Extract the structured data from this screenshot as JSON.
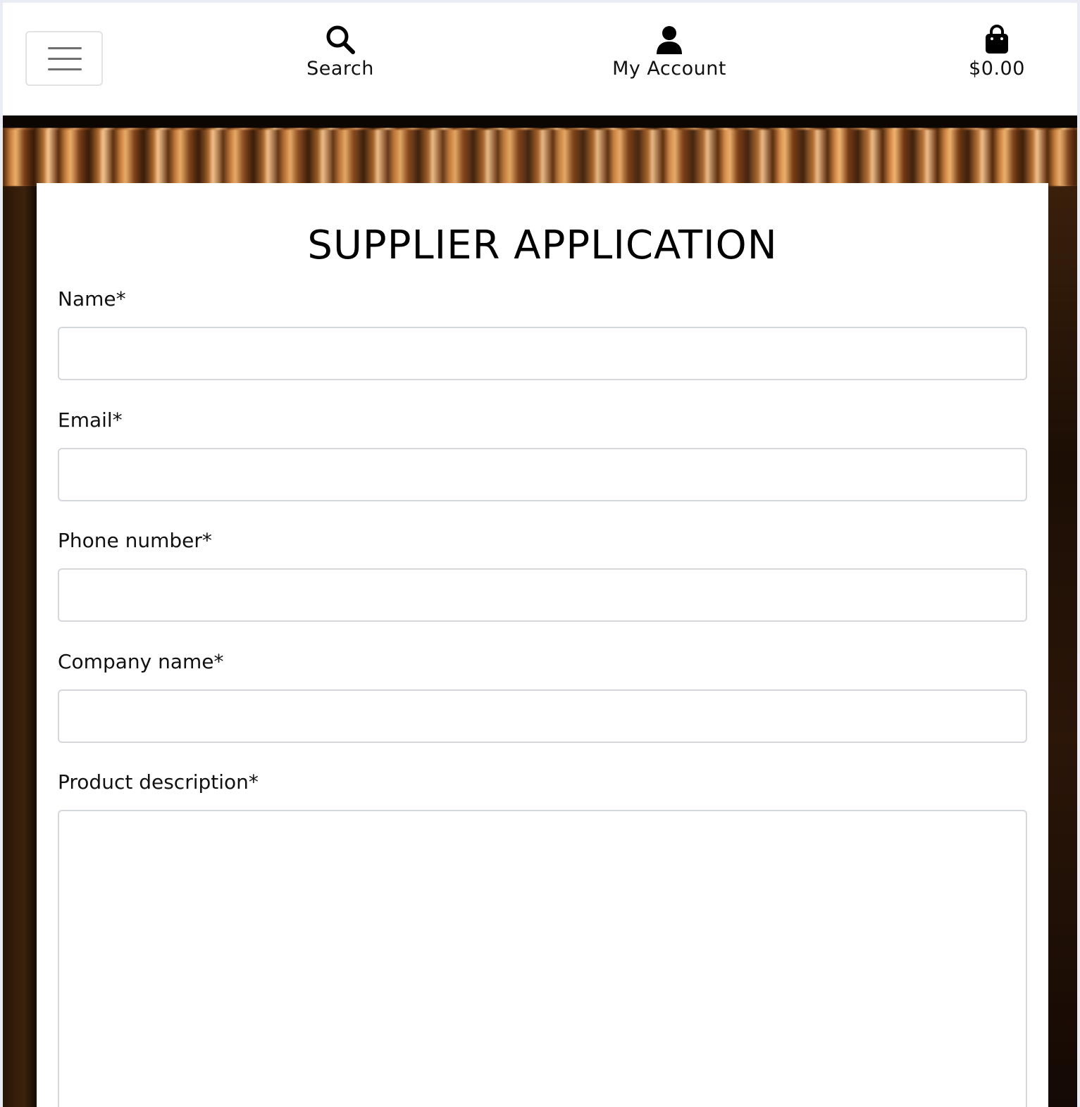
{
  "header": {
    "nav": [
      {
        "label": "Search",
        "icon": "search-icon"
      },
      {
        "label": "My Account",
        "icon": "user-icon"
      },
      {
        "label": "$0.00",
        "icon": "shopping-bag-icon"
      }
    ],
    "menu_icon": "hamburger-menu-icon"
  },
  "form": {
    "title": "SUPPLIER APPLICATION",
    "fields": [
      {
        "label": "Name*",
        "value": ""
      },
      {
        "label": "Email*",
        "value": ""
      },
      {
        "label": "Phone number*",
        "value": ""
      },
      {
        "label": "Company name*",
        "value": ""
      },
      {
        "label": "Product description*",
        "value": ""
      }
    ]
  },
  "colors": {
    "text": "#111111",
    "input_border": "#d4d7dc",
    "hero_accent": "#b9733a"
  }
}
